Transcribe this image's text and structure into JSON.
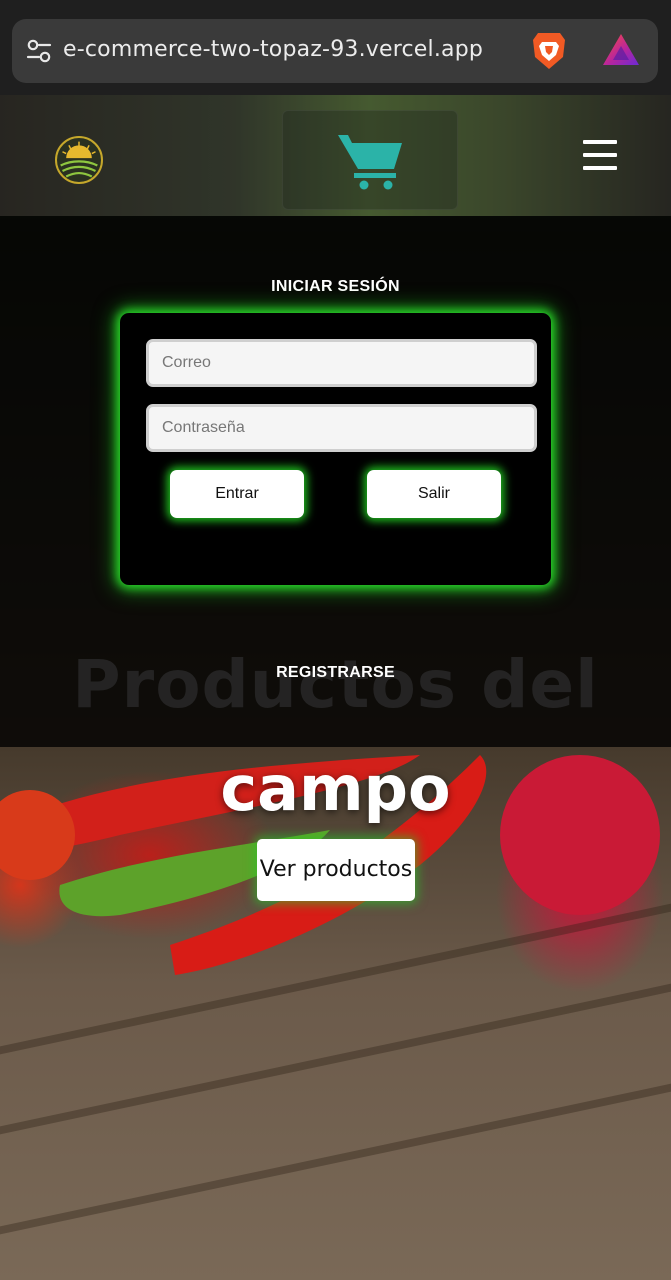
{
  "browser": {
    "url": "e-commerce-two-topaz-93.vercel.app",
    "icons": [
      "site-settings-icon",
      "brave-lion-icon",
      "brave-rewards-triangle-icon"
    ]
  },
  "header": {
    "icons": [
      "logo-sunrise-field-icon",
      "shopping-cart-icon",
      "hamburger-menu-icon"
    ],
    "cart_color": "#2bb3a8"
  },
  "login": {
    "title": "INICIAR SESIÓN",
    "email_placeholder": "Correo",
    "password_placeholder": "Contraseña",
    "enter_label": "Entrar",
    "exit_label": "Salir",
    "register_label": "REGISTRARSE",
    "glow_color": "#2bdc2b"
  },
  "hero": {
    "line1": "Productos del",
    "line2": "campo",
    "cta_label": "Ver productos"
  }
}
